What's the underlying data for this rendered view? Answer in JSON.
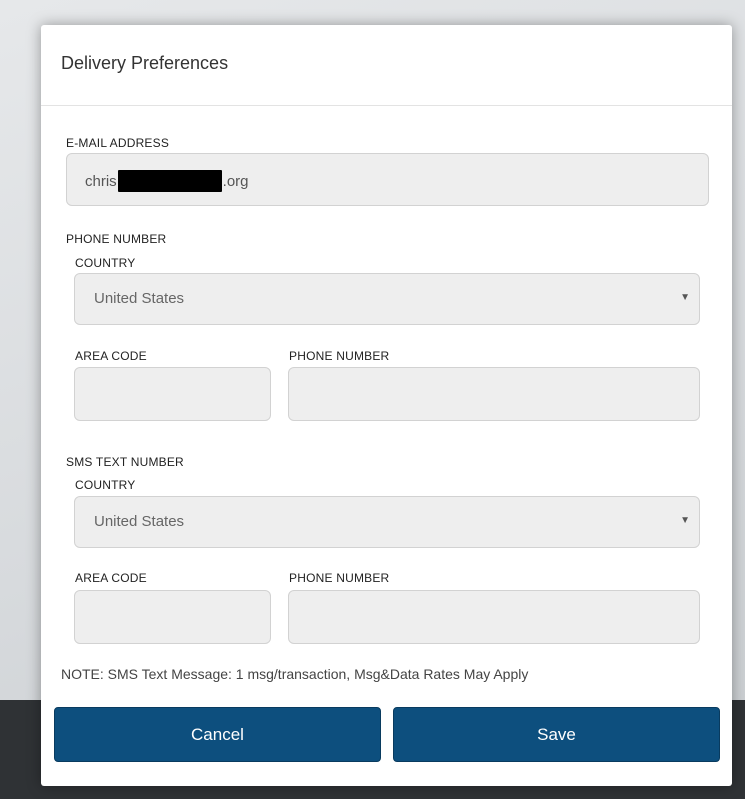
{
  "modal": {
    "title": "Delivery Preferences"
  },
  "email": {
    "label": "E-MAIL ADDRESS",
    "value_prefix": "chris",
    "value_suffix": ".org"
  },
  "phone": {
    "section_label": "PHONE NUMBER",
    "country_label": "COUNTRY",
    "country_value": "United States",
    "area_code_label": "AREA CODE",
    "area_code_value": "",
    "number_label": "PHONE NUMBER",
    "number_value": ""
  },
  "sms": {
    "section_label": "SMS TEXT NUMBER",
    "country_label": "COUNTRY",
    "country_value": "United States",
    "area_code_label": "AREA CODE",
    "area_code_value": "",
    "number_label": "PHONE NUMBER",
    "number_value": ""
  },
  "note": "NOTE: SMS Text Message: 1 msg/transaction, Msg&Data Rates May Apply",
  "buttons": {
    "cancel": "Cancel",
    "save": "Save"
  },
  "icons": {
    "select_caret": "caret-down-icon"
  },
  "colors": {
    "button_bg": "#0d4f7e",
    "field_bg": "#eeeeee"
  }
}
